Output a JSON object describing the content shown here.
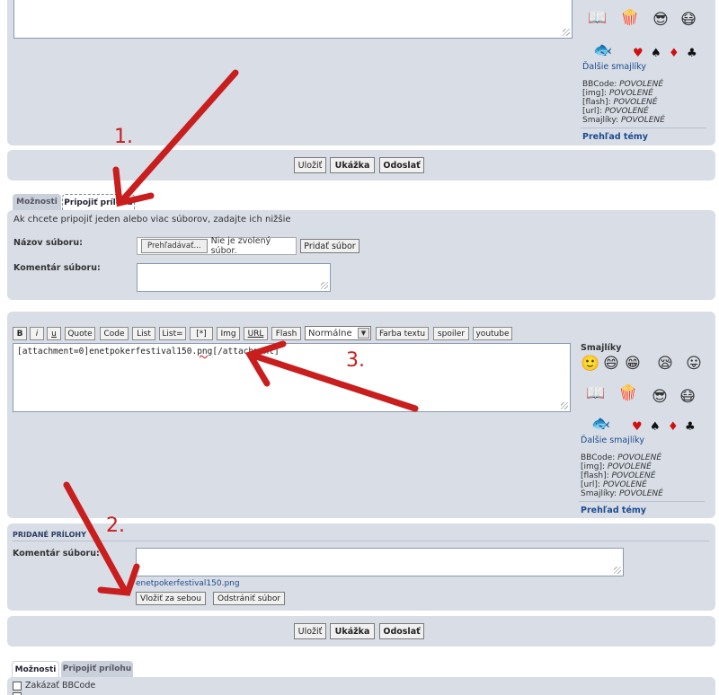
{
  "smileys": {
    "more_link": "Ďalšie smajlíky",
    "heading": "Smajlíky",
    "icons": [
      "reading-smiley-icon",
      "popcorn-smiley-icon",
      "sunglasses-smiley-icon",
      "nurse-smiley-icon",
      "fish-smiley-icon",
      "happy-smiley-icon",
      "grin-smiley-icon",
      "teeth-smiley-icon",
      "sleepy-smiley-icon",
      "tongue-smiley-icon"
    ],
    "suits": [
      "♥",
      "♠",
      "♦",
      "♣"
    ]
  },
  "bbcode_status": {
    "bbcode_label": "BBCode:",
    "bbcode_value": "POVOLENÉ",
    "img_label": "[img]:",
    "img_value": "POVOLENÉ",
    "flash_label": "[flash]:",
    "flash_value": "POVOLENÉ",
    "url_label": "[url]:",
    "url_value": "POVOLENÉ",
    "smileys_label": "Smajlíky:",
    "smileys_value": "POVOLENÉ"
  },
  "topic_review_link": "Prehľad témy",
  "submit_bar": {
    "save": "Uložiť",
    "preview": "Ukážka",
    "send": "Odoslať"
  },
  "tabs_top": {
    "options": "Možnosti",
    "attach": "Pripojiť prílohu"
  },
  "attach_panel": {
    "intro": "Ak chcete pripojiť jeden alebo viac súborov, zadajte ich nižšie",
    "filename_label": "Názov súboru:",
    "browse_button": "Prehľadávať...",
    "no_file_text": "Nie je zvolený súbor.",
    "add_file_button": "Pridať súbor",
    "comment_label": "Komentár súboru:"
  },
  "toolbar": {
    "b": "B",
    "i": "i",
    "u": "u",
    "quote": "Quote",
    "code": "Code",
    "list": "List",
    "list_eq": "List=",
    "star": "[*]",
    "img": "Img",
    "url": "URL",
    "flash": "Flash",
    "font_size": "Normálne",
    "color": "Farba textu",
    "spoiler": "spoiler",
    "youtube": "youtube"
  },
  "editor": {
    "content_prefix": "[attachment=0]enetpokerfestival150.",
    "content_png": "png",
    "content_suffix": "[/attachment]"
  },
  "added_attachments": {
    "heading": "PRIDANÉ PRÍLOHY",
    "comment_label": "Komentár súboru:",
    "file_link": "enetpokerfestival150.png",
    "inline_button": "Vložiť za sebou",
    "remove_button": "Odstrániť súbor"
  },
  "tabs_bottom": {
    "options": "Možnosti",
    "attach": "Pripojiť prílohu"
  },
  "options": {
    "disable_bbcode": "Zakázať BBCode"
  },
  "annotations": {
    "step1": "1.",
    "step2": "2.",
    "step3": "3."
  },
  "colors": {
    "panel": "#d8dde6",
    "link": "#1d4b8f",
    "arrow": "#c81e1e"
  }
}
